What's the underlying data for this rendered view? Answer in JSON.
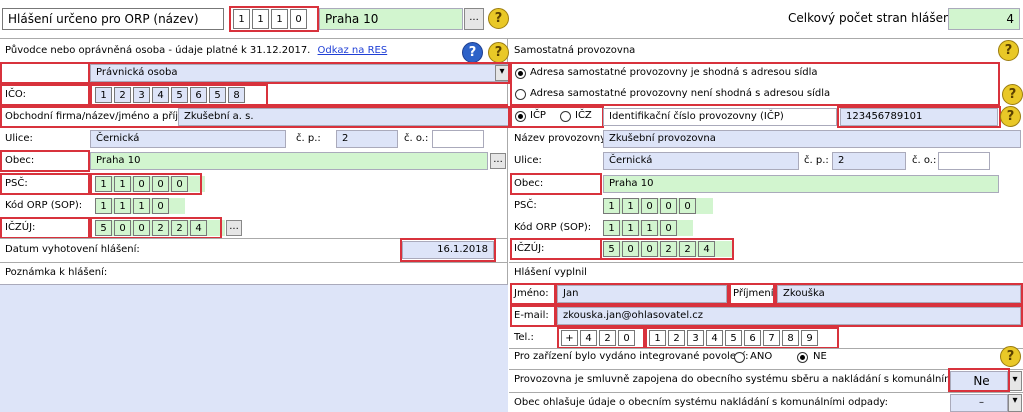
{
  "header": {
    "orp_label": "Hlášení určeno pro ORP (název)",
    "orp_code": [
      "1",
      "1",
      "1",
      "0"
    ],
    "orp_name": "Praha 10",
    "pages_label": "Celkový počet stran hlášení",
    "pages_value": "4"
  },
  "left": {
    "section_title": "Původce nebo oprávněná osoba - údaje platné k 31.12.2017.",
    "res_link": "Odkaz na RES",
    "legal_form": "Právnická osoba",
    "ico_label": "IČO:",
    "ico": [
      "1",
      "2",
      "3",
      "4",
      "5",
      "6",
      "5",
      "8"
    ],
    "company_label": "Obchodní firma/název/jméno a příjmení:",
    "company": "Zkušební a. s.",
    "street_label": "Ulice:",
    "street": "Černická",
    "cp_label": "č. p.:",
    "cp": "2",
    "co_label": "č. o.:",
    "co": "",
    "city_label": "Obec:",
    "city": "Praha 10",
    "psc_label": "PSČ:",
    "psc": [
      "1",
      "1",
      "0",
      "0",
      "0"
    ],
    "orp_sop_label": "Kód ORP (SOP):",
    "orp_sop": [
      "1",
      "1",
      "1",
      "0"
    ],
    "iczuj_label": "IČZÚJ:",
    "iczuj": [
      "5",
      "0",
      "0",
      "2",
      "2",
      "4"
    ],
    "date_label": "Datum vyhotovení hlášení:",
    "date": "16.1.2018",
    "note_label": "Poznámka k hlášení:"
  },
  "right": {
    "section_title": "Samostatná provozovna",
    "opt_same": "Adresa samostatné provozovny je shodná s adresou sídla",
    "opt_diff": "Adresa samostatné provozovny není shodná s adresou sídla",
    "icp_label": "IČP",
    "icz_label": "IČZ",
    "icp_field_label": "Identifikační číslo provozovny (IČP)",
    "icp_value": "123456789101",
    "name_label": "Název provozovny:",
    "name": "Zkušební provozovna",
    "street_label": "Ulice:",
    "street": "Černická",
    "cp_label": "č. p.:",
    "cp": "2",
    "co_label": "č. o.:",
    "co": "",
    "city_label": "Obec:",
    "city": "Praha 10",
    "psc_label": "PSČ:",
    "psc": [
      "1",
      "1",
      "0",
      "0",
      "0"
    ],
    "orp_sop_label": "Kód ORP (SOP):",
    "orp_sop": [
      "1",
      "1",
      "1",
      "0"
    ],
    "iczuj_label": "IČZÚJ:",
    "iczuj": [
      "5",
      "0",
      "0",
      "2",
      "2",
      "4"
    ],
    "filled_title": "Hlášení vyplnil",
    "first_label": "Jméno:",
    "first": "Jan",
    "last_label": "Příjmení:",
    "last": "Zkouška",
    "email_label": "E-mail:",
    "email": "zkouska.jan@ohlasovatel.cz",
    "tel_label": "Tel.:",
    "tel_prefix": [
      "+",
      "4",
      "2",
      "0"
    ],
    "tel": [
      "1",
      "2",
      "3",
      "4",
      "5",
      "6",
      "7",
      "8",
      "9"
    ],
    "ipp_label": "Pro zařízení bylo vydáno integrované povolení:",
    "ano": "ANO",
    "ne": "NE",
    "contract_label": "Provozovna je smluvně zapojena do obecního systému sběru a nakládání s komunálními odpady:",
    "contract_value": "Ne",
    "obec_label": "Obec ohlašuje údaje o obecním systému nakládání s komunálními odpady:",
    "obec_value": "–"
  },
  "icons": {
    "help": "question-help-icon",
    "dropdown": "chevron-down-icon",
    "browse": "ellipsis-icon"
  }
}
